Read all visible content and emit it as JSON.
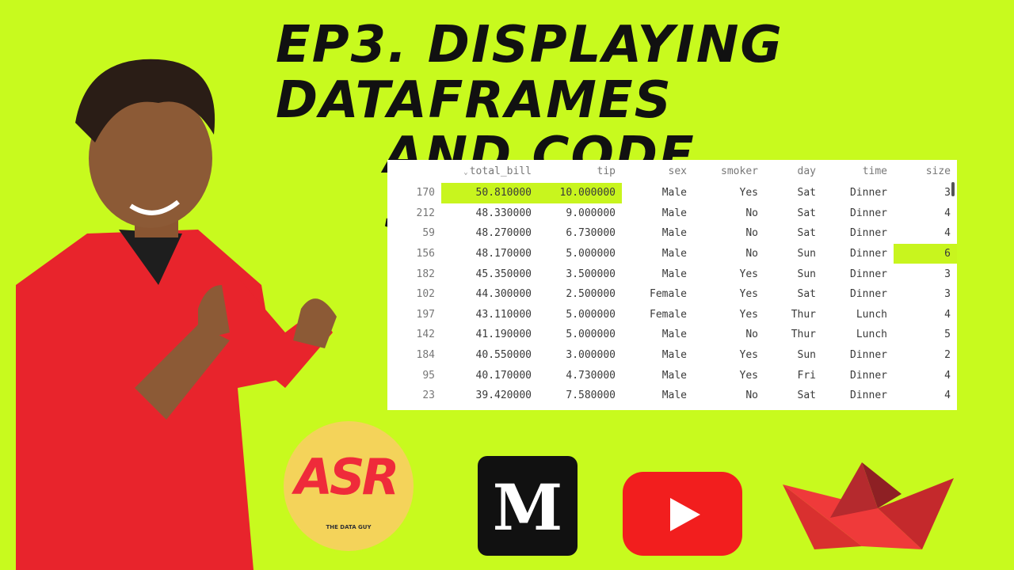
{
  "title": {
    "line1": "EP3. DISPLAYING DATAFRAMES",
    "line2": "AND CODE SNIPPETS"
  },
  "dataframe": {
    "columns": [
      "total_bill",
      "tip",
      "sex",
      "smoker",
      "day",
      "time",
      "size"
    ],
    "sort_indicator": "⌄",
    "rows": [
      {
        "idx": "170",
        "total_bill": "50.810000",
        "tip": "10.000000",
        "sex": "Male",
        "smoker": "Yes",
        "day": "Sat",
        "time": "Dinner",
        "size": "3"
      },
      {
        "idx": "212",
        "total_bill": "48.330000",
        "tip": "9.000000",
        "sex": "Male",
        "smoker": "No",
        "day": "Sat",
        "time": "Dinner",
        "size": "4"
      },
      {
        "idx": "59",
        "total_bill": "48.270000",
        "tip": "6.730000",
        "sex": "Male",
        "smoker": "No",
        "day": "Sat",
        "time": "Dinner",
        "size": "4"
      },
      {
        "idx": "156",
        "total_bill": "48.170000",
        "tip": "5.000000",
        "sex": "Male",
        "smoker": "No",
        "day": "Sun",
        "time": "Dinner",
        "size": "6"
      },
      {
        "idx": "182",
        "total_bill": "45.350000",
        "tip": "3.500000",
        "sex": "Male",
        "smoker": "Yes",
        "day": "Sun",
        "time": "Dinner",
        "size": "3"
      },
      {
        "idx": "102",
        "total_bill": "44.300000",
        "tip": "2.500000",
        "sex": "Female",
        "smoker": "Yes",
        "day": "Sat",
        "time": "Dinner",
        "size": "3"
      },
      {
        "idx": "197",
        "total_bill": "43.110000",
        "tip": "5.000000",
        "sex": "Female",
        "smoker": "Yes",
        "day": "Thur",
        "time": "Lunch",
        "size": "4"
      },
      {
        "idx": "142",
        "total_bill": "41.190000",
        "tip": "5.000000",
        "sex": "Male",
        "smoker": "No",
        "day": "Thur",
        "time": "Lunch",
        "size": "5"
      },
      {
        "idx": "184",
        "total_bill": "40.550000",
        "tip": "3.000000",
        "sex": "Male",
        "smoker": "Yes",
        "day": "Sun",
        "time": "Dinner",
        "size": "2"
      },
      {
        "idx": "95",
        "total_bill": "40.170000",
        "tip": "4.730000",
        "sex": "Male",
        "smoker": "Yes",
        "day": "Fri",
        "time": "Dinner",
        "size": "4"
      },
      {
        "idx": "23",
        "total_bill": "39.420000",
        "tip": "7.580000",
        "sex": "Male",
        "smoker": "No",
        "day": "Sat",
        "time": "Dinner",
        "size": "4"
      }
    ],
    "highlighted_cells": [
      {
        "row": 0,
        "col": "total_bill"
      },
      {
        "row": 0,
        "col": "tip"
      },
      {
        "row": 3,
        "col": "size"
      }
    ],
    "highlight_color": "#c8f51e"
  },
  "logos": {
    "asr": {
      "letters": "ASR",
      "tagline": "THE DATA GUY"
    },
    "medium": {
      "letter": "M"
    },
    "youtube": {
      "icon": "play-icon"
    },
    "streamlit": {
      "icon": "crown-icon"
    }
  },
  "colors": {
    "background": "#c8fa1e",
    "shirt": "#e8242c",
    "youtube_red": "#f21e1e"
  }
}
